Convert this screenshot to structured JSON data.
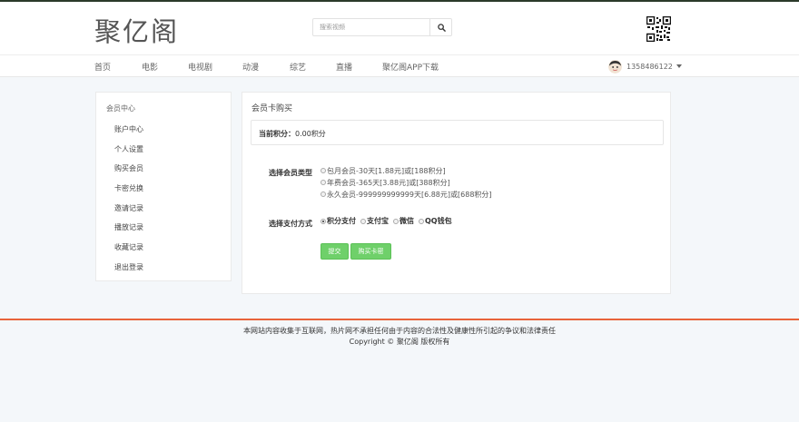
{
  "header": {
    "logo": "聚亿阁",
    "search": {
      "placeholder": "搜索视频"
    }
  },
  "nav": {
    "items": [
      "首页",
      "电影",
      "电视剧",
      "动漫",
      "综艺",
      "直播",
      "聚亿阁APP下载"
    ],
    "user": "1358486122"
  },
  "sidebar": {
    "title": "会员中心",
    "items": [
      "账户中心",
      "个人设置",
      "购买会员",
      "卡密兑换",
      "邀请记录",
      "播放记录",
      "收藏记录",
      "退出登录"
    ]
  },
  "main": {
    "title": "会员卡购买",
    "points_label": "当前积分：",
    "points_value": "0.00积分",
    "member_type_label": "选择会员类型",
    "member_options": [
      "包月会员-30天[1.88元]或[188积分]",
      "年费会员-365天[3.88元]或[388积分]",
      "永久会员-999999999999天[6.88元]或[688积分]"
    ],
    "pay_label": "选择支付方式",
    "pay_options": [
      "积分支付",
      "支付宝",
      "微信",
      "QQ钱包"
    ],
    "submit_label": "提交",
    "buy_card_label": "购买卡密"
  },
  "footer": {
    "line1": "本网站内容收集于互联网，热片网不承担任何由于内容的合法性及健康性所引起的争议和法律责任",
    "line2": "Copyright ©  聚亿阁 版权所有"
  },
  "colors": {
    "accent_green": "#6fd06a",
    "footer_border": "#e8633a",
    "background": "#f4f7fa"
  }
}
